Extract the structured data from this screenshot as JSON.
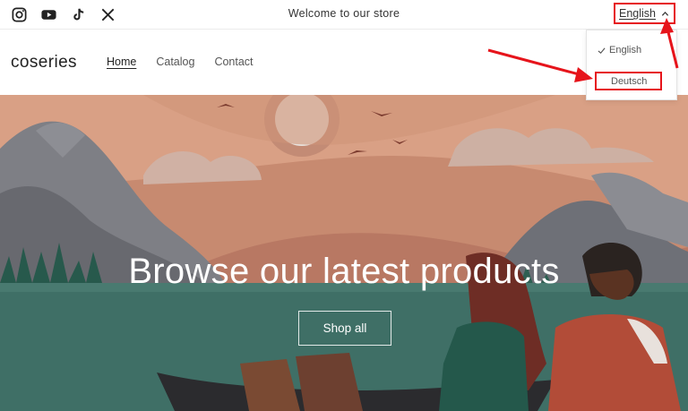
{
  "topbar": {
    "social_icons": [
      "instagram-icon",
      "youtube-icon",
      "tiktok-icon",
      "x-icon"
    ],
    "announcement": "Welcome to our store",
    "language": "English"
  },
  "header": {
    "logo": "coseries",
    "nav": [
      {
        "label": "Home",
        "active": true
      },
      {
        "label": "Catalog",
        "active": false
      },
      {
        "label": "Contact",
        "active": false
      }
    ]
  },
  "hero": {
    "title": "Browse our latest products",
    "button": "Shop all"
  },
  "language_dropdown": {
    "options": [
      {
        "label": "English",
        "selected": true
      },
      {
        "label": "Deutsch",
        "selected": false
      }
    ]
  },
  "colors": {
    "annotation": "#e6141b",
    "sky": "#c98a70",
    "water": "#3f6f66"
  }
}
